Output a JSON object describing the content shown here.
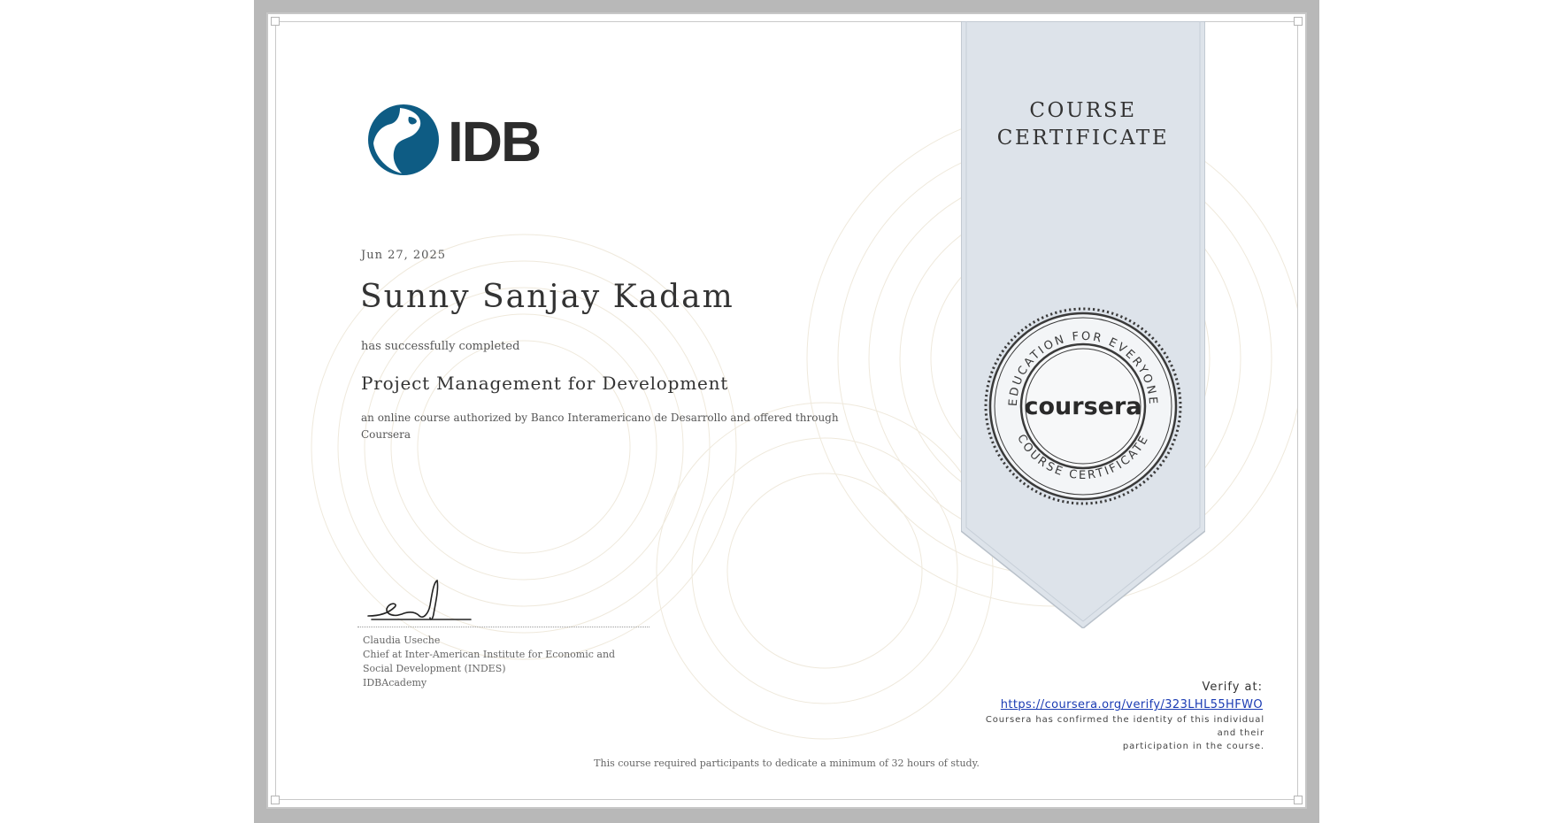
{
  "certificate": {
    "issuer_logo": {
      "text": "IDB",
      "icon": "idb-globe-logo",
      "brand_color": "#0e5c84"
    },
    "ribbon": {
      "line1": "COURSE",
      "line2": "CERTIFICATE",
      "color": "#dde3ea"
    },
    "seal": {
      "top_arc": "EDUCATION FOR EVERYONE",
      "bottom_arc": "COURSE CERTIFICATE",
      "brand": "coursera",
      "icon": "coursera-seal"
    },
    "date": "Jun 27, 2025",
    "recipient_name": "Sunny Sanjay Kadam",
    "completion_text": "has successfully completed",
    "course_title": "Project Management for Development",
    "description": "an online course authorized by Banco Interamericano de Desarrollo and offered through Coursera",
    "signatory": {
      "name": "Claudia Useche",
      "title": "Chief at Inter-American Institute for Economic and Social Development (INDES)",
      "organization": "IDBAcademy"
    },
    "verify": {
      "label": "Verify at:",
      "url": "https://coursera.org/verify/323LHL55HFWO",
      "confirmation_line1": "Coursera has confirmed the identity of this individual and their",
      "confirmation_line2": "participation in the course."
    },
    "footnote": "This course required participants to dedicate a minimum of 32 hours of study."
  }
}
